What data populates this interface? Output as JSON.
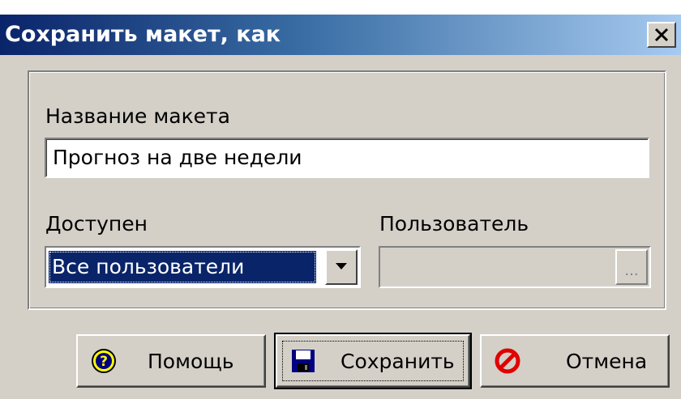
{
  "window": {
    "title": "Сохранить макет, как",
    "close_glyph": "X"
  },
  "form": {
    "name_label": "Название макета",
    "name_value": "Прогноз на две недели",
    "access_label": "Доступен",
    "access_value": "Все пользователи",
    "user_label": "Пользователь",
    "user_value": "",
    "browse_label": "..."
  },
  "buttons": {
    "help_label": "Помощь",
    "save_label": "Сохранить",
    "cancel_label": "Отмена"
  },
  "icons": {
    "help": "help-question-icon",
    "save": "floppy-disk-icon",
    "cancel": "stop-sign-icon",
    "dropdown": "chevron-down-icon",
    "close": "close-icon"
  },
  "colors": {
    "title_bar_start": "#0a246a",
    "title_bar_end": "#a6caf0",
    "dialog_face": "#d4d0c8",
    "selection": "#0a246a"
  }
}
